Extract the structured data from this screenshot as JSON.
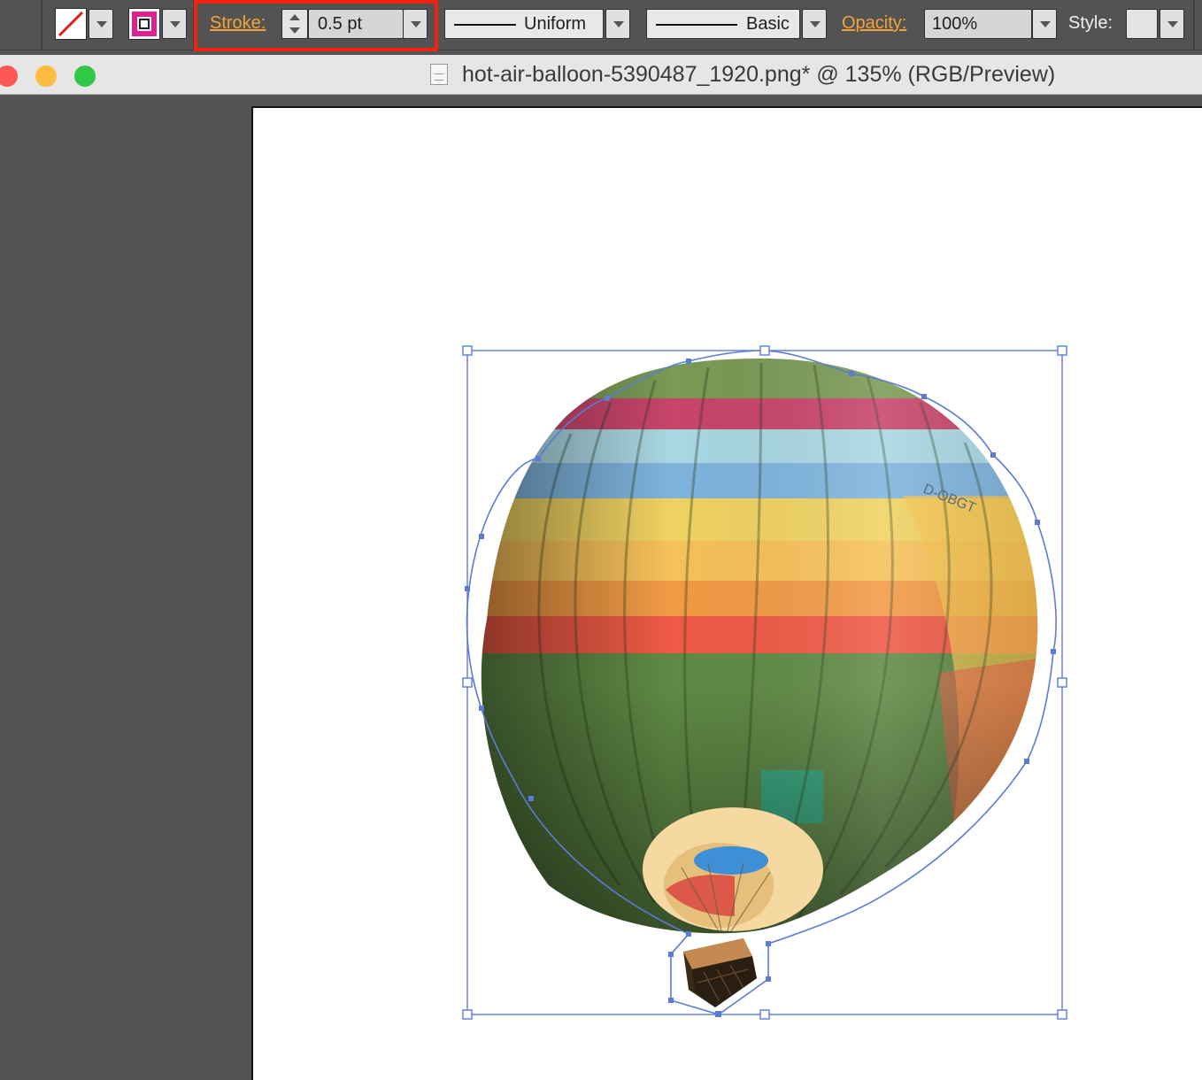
{
  "control_bar": {
    "fill_swatch": "fill-none",
    "stroke_swatch": "stroke-magenta",
    "stroke_label": "Stroke:",
    "stroke_weight": "0.5 pt",
    "profile": "Uniform",
    "brush": "Basic",
    "opacity_label": "Opacity:",
    "opacity_value": "100%",
    "style_label": "Style:",
    "highlight_color": "#f4230d",
    "label_color": "#f1a33a"
  },
  "window": {
    "title": "hot-air-balloon-5390487_1920.png* @ 135% (RGB/Preview)",
    "buttons": {
      "close": "#fc5753",
      "minimize": "#fdbc40",
      "zoom": "#33c748"
    }
  },
  "canvas": {
    "background": "#ffffff",
    "pasteboard": "#535353",
    "selection_color": "#5b7bd5"
  },
  "image_text": {
    "balloon_registration": "D-OBGT"
  }
}
